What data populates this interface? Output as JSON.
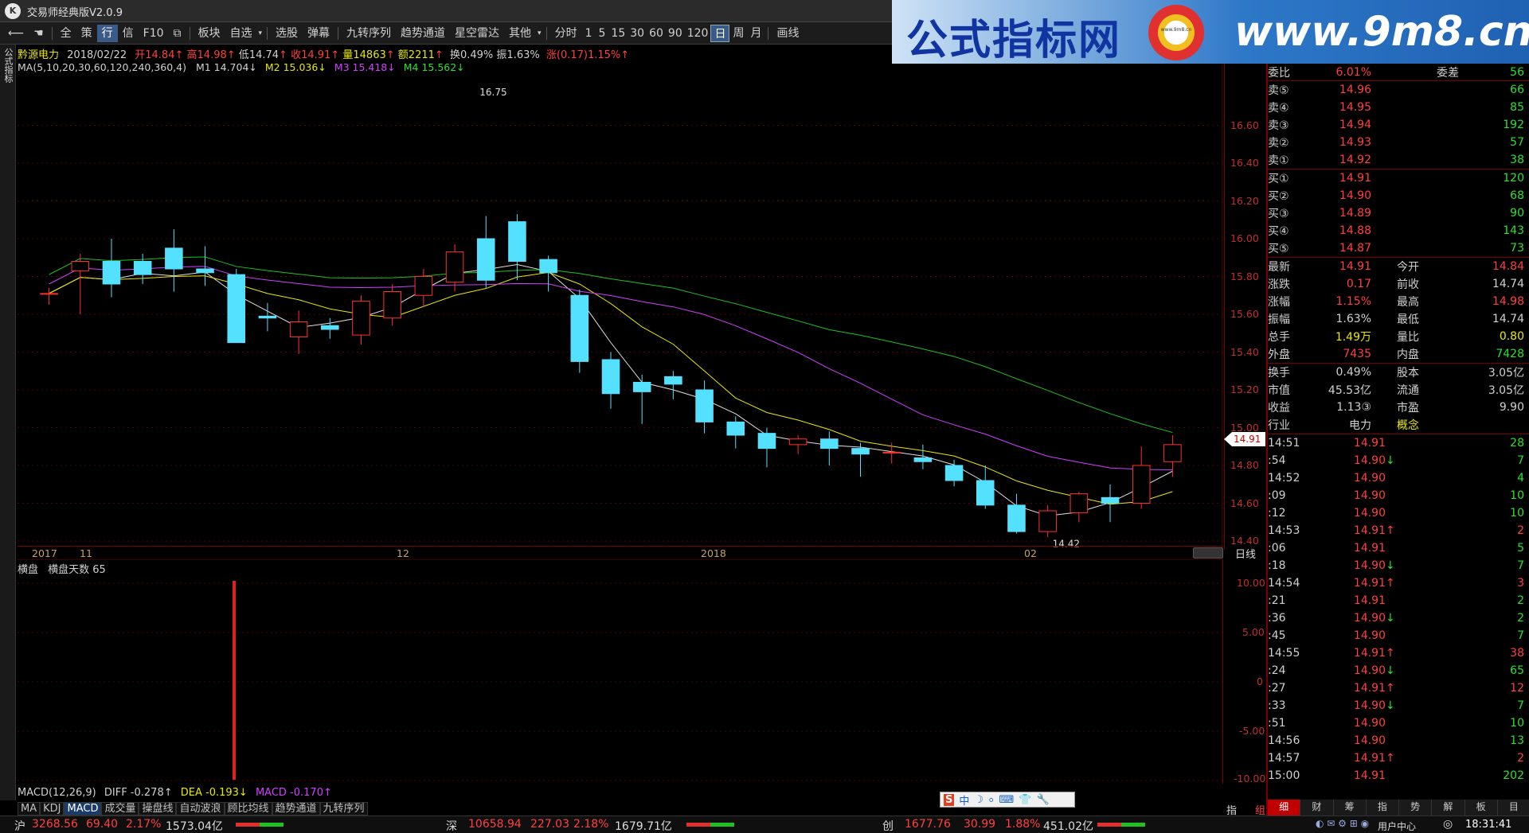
{
  "window": {
    "title": "交易师经典版V2.0.9"
  },
  "toolbar": {
    "items": [
      "全",
      "策",
      "行",
      "信",
      "F10",
      "板块",
      "自选",
      "选股",
      "弹幕",
      "九转序列",
      "趋势通道",
      "星空雷达",
      "其他",
      "分时",
      "1",
      "5",
      "15",
      "30",
      "60",
      "90",
      "120",
      "日",
      "周",
      "月",
      "画线"
    ],
    "active": "行",
    "active_period": "日"
  },
  "banner": {
    "text": "公式指标网",
    "url": "www.9m8.cn",
    "logo_text": "www.9m8.cn"
  },
  "leftstrip": {
    "label": "公式指标"
  },
  "stock": {
    "name": "黔源电力",
    "date": "2018/02/22",
    "open_label": "开",
    "open": "14.84",
    "high_label": "高",
    "high": "14.98",
    "low_label": "低",
    "low": "14.74",
    "close_label": "收",
    "close": "14.91",
    "vol_label": "量",
    "vol": "14863",
    "amt_label": "额",
    "amt": "2211",
    "turn_label": "换",
    "turn": "0.49%",
    "amp_label": "振",
    "amp": "1.63%",
    "chg_label": "涨",
    "chg": "(0.17)",
    "chgpct": "1.15%"
  },
  "ma": {
    "label": "MA(5,10,20,30,60,120,240,360,4)",
    "m1": "M1 14.704↓",
    "m2": "M2 15.036↓",
    "m3": "M3 15.418↓",
    "m4": "M4 15.562↓"
  },
  "price_axis": [
    "16.60",
    "16.40",
    "16.20",
    "16.00",
    "15.80",
    "15.60",
    "15.40",
    "15.20",
    "15.00",
    "14.80",
    "14.60",
    "14.40"
  ],
  "price_marks": {
    "high": "16.75",
    "low": "14.42",
    "current": "14.91"
  },
  "x_axis": [
    "2017",
    "11",
    "12",
    "2018",
    "02"
  ],
  "period_label": "日线",
  "sub": {
    "title": "横盘",
    "subtitle": "横盘天数 65",
    "axis": [
      "10.00",
      "5.00",
      "0",
      "-5.00",
      "-10.00"
    ],
    "macd": {
      "label": "MACD(12,26,9)",
      "diff": "DIFF -0.278↑",
      "dea": "DEA -0.193↓",
      "macd": "MACD -0.170↑"
    }
  },
  "tabs": [
    "MA",
    "KDJ",
    "MACD",
    "成交量",
    "操盘线",
    "自动波浪",
    "顾比均线",
    "趋势通道",
    "九转序列"
  ],
  "ime": {
    "items": [
      "S",
      "中",
      "☽",
      "⸰",
      "⌨",
      "👕",
      "🔧"
    ]
  },
  "side": {
    "header": {
      "wb_label": "委比",
      "wb": "6.01%",
      "wc_label": "委差",
      "wc": "56"
    },
    "sells": [
      {
        "l": "卖⑤",
        "p": "14.96",
        "v": "66"
      },
      {
        "l": "卖④",
        "p": "14.95",
        "v": "85"
      },
      {
        "l": "卖③",
        "p": "14.94",
        "v": "192"
      },
      {
        "l": "卖②",
        "p": "14.93",
        "v": "57"
      },
      {
        "l": "卖①",
        "p": "14.92",
        "v": "38"
      }
    ],
    "buys": [
      {
        "l": "买①",
        "p": "14.91",
        "v": "120"
      },
      {
        "l": "买②",
        "p": "14.90",
        "v": "68"
      },
      {
        "l": "买③",
        "p": "14.89",
        "v": "90"
      },
      {
        "l": "买④",
        "p": "14.88",
        "v": "143"
      },
      {
        "l": "买⑤",
        "p": "14.87",
        "v": "73"
      }
    ],
    "stats": [
      {
        "a": "最新",
        "av": "14.91",
        "b": "今开",
        "bv": "14.84"
      },
      {
        "a": "涨跌",
        "av": "0.17",
        "b": "前收",
        "bv": "14.74"
      },
      {
        "a": "涨幅",
        "av": "1.15%",
        "b": "最高",
        "bv": "14.98"
      },
      {
        "a": "振幅",
        "av": "1.63%",
        "b": "最低",
        "bv": "14.74"
      },
      {
        "a": "总手",
        "av": "1.49万",
        "b": "量比",
        "bv": "0.80"
      },
      {
        "a": "外盘",
        "av": "7435",
        "b": "内盘",
        "bv": "7428"
      }
    ],
    "stats2": [
      {
        "a": "换手",
        "av": "0.49%",
        "b": "股本",
        "bv": "3.05亿"
      },
      {
        "a": "市值",
        "av": "45.53亿",
        "b": "流通",
        "bv": "3.05亿"
      },
      {
        "a": "收益",
        "av": "1.13③",
        "b": "市盈",
        "bv": "9.90"
      },
      {
        "a": "行业",
        "av": "电力",
        "b": "概念",
        "bv": ""
      }
    ],
    "ticks": [
      {
        "t": "14:51",
        "p": "14.91",
        "a": "",
        "v": "28"
      },
      {
        "t": ":54",
        "p": "14.90",
        "a": "↓",
        "v": "7"
      },
      {
        "t": "14:52",
        "p": "14.90",
        "a": "",
        "v": "4"
      },
      {
        "t": ":09",
        "p": "14.90",
        "a": "",
        "v": "10"
      },
      {
        "t": ":12",
        "p": "14.90",
        "a": "",
        "v": "10"
      },
      {
        "t": "14:53",
        "p": "14.91",
        "a": "↑",
        "v": "2"
      },
      {
        "t": ":06",
        "p": "14.91",
        "a": "",
        "v": "5"
      },
      {
        "t": ":18",
        "p": "14.90",
        "a": "↓",
        "v": "7"
      },
      {
        "t": "14:54",
        "p": "14.91",
        "a": "↑",
        "v": "3"
      },
      {
        "t": ":21",
        "p": "14.91",
        "a": "",
        "v": "2"
      },
      {
        "t": ":36",
        "p": "14.90",
        "a": "↓",
        "v": "2"
      },
      {
        "t": ":45",
        "p": "14.90",
        "a": "",
        "v": "7"
      },
      {
        "t": "14:55",
        "p": "14.91",
        "a": "↑",
        "v": "38"
      },
      {
        "t": ":24",
        "p": "14.90",
        "a": "↓",
        "v": "65"
      },
      {
        "t": ":27",
        "p": "14.91",
        "a": "↑",
        "v": "12"
      },
      {
        "t": ":33",
        "p": "14.90",
        "a": "↓",
        "v": "7"
      },
      {
        "t": ":51",
        "p": "14.90",
        "a": "",
        "v": "10"
      },
      {
        "t": "14:56",
        "p": "14.90",
        "a": "",
        "v": "13"
      },
      {
        "t": "14:57",
        "p": "14.91",
        "a": "↑",
        "v": "2"
      },
      {
        "t": "15:00",
        "p": "14.91",
        "a": "",
        "v": "202"
      }
    ],
    "bottom_tabs": [
      "细",
      "财",
      "筹",
      "指",
      "势",
      "解",
      "板",
      "目"
    ],
    "zhi": "指",
    "zu": "组"
  },
  "status": {
    "sh": {
      "label": "沪",
      "index": "3268.56",
      "chg": "69.40",
      "pct": "2.17%",
      "amt": "1573.04亿"
    },
    "sz": {
      "label": "深",
      "index": "10658.94",
      "chg": "227.03",
      "pct": "2.18%",
      "amt": "1679.71亿"
    },
    "cy": {
      "label": "创",
      "index": "1677.76",
      "chg": "30.99",
      "pct": "1.88%",
      "amt": "451.02亿"
    },
    "user": "用户中心",
    "time": "18:31:41"
  },
  "colors": {
    "up": "#ff3030",
    "down": "#54e0ff",
    "bg": "#000000",
    "grid": "#5a0000"
  },
  "candles": [
    [
      15.71,
      15.74,
      15.65,
      15.71
    ],
    [
      15.83,
      15.92,
      15.6,
      15.88
    ],
    [
      15.88,
      16.0,
      15.69,
      15.76
    ],
    [
      15.88,
      15.92,
      15.76,
      15.81
    ],
    [
      15.95,
      16.05,
      15.72,
      15.84
    ],
    [
      15.84,
      15.96,
      15.75,
      15.82
    ],
    [
      15.81,
      15.84,
      15.52,
      15.45
    ],
    [
      15.59,
      15.66,
      15.51,
      15.58
    ],
    [
      15.48,
      15.62,
      15.39,
      15.56
    ],
    [
      15.54,
      15.58,
      15.47,
      15.52
    ],
    [
      15.49,
      15.7,
      15.44,
      15.67
    ],
    [
      15.58,
      15.76,
      15.54,
      15.72
    ],
    [
      15.7,
      15.84,
      15.64,
      15.8
    ],
    [
      15.77,
      15.97,
      15.72,
      15.93
    ],
    [
      16.0,
      16.12,
      15.74,
      15.78
    ],
    [
      16.09,
      16.13,
      15.78,
      15.88
    ],
    [
      15.89,
      15.91,
      15.72,
      15.82
    ],
    [
      15.7,
      15.73,
      15.29,
      15.35
    ],
    [
      15.36,
      15.4,
      15.1,
      15.18
    ],
    [
      15.24,
      15.28,
      15.02,
      15.19
    ],
    [
      15.27,
      15.3,
      15.15,
      15.23
    ],
    [
      15.2,
      15.25,
      14.97,
      15.03
    ],
    [
      15.03,
      15.06,
      14.89,
      14.96
    ],
    [
      14.97,
      15.0,
      14.79,
      14.89
    ],
    [
      14.91,
      14.96,
      14.86,
      14.94
    ],
    [
      14.94,
      14.98,
      14.8,
      14.89
    ],
    [
      14.89,
      14.92,
      14.74,
      14.86
    ],
    [
      14.87,
      14.92,
      14.81,
      14.87
    ],
    [
      14.84,
      14.91,
      14.78,
      14.82
    ],
    [
      14.8,
      14.83,
      14.69,
      14.72
    ],
    [
      14.72,
      14.8,
      14.57,
      14.59
    ],
    [
      14.59,
      14.65,
      14.44,
      14.45
    ],
    [
      14.45,
      14.59,
      14.42,
      14.56
    ],
    [
      14.55,
      14.66,
      14.5,
      14.65
    ],
    [
      14.63,
      14.7,
      14.5,
      14.6
    ],
    [
      14.6,
      14.9,
      14.57,
      14.8
    ],
    [
      14.82,
      14.96,
      14.74,
      14.91
    ]
  ]
}
